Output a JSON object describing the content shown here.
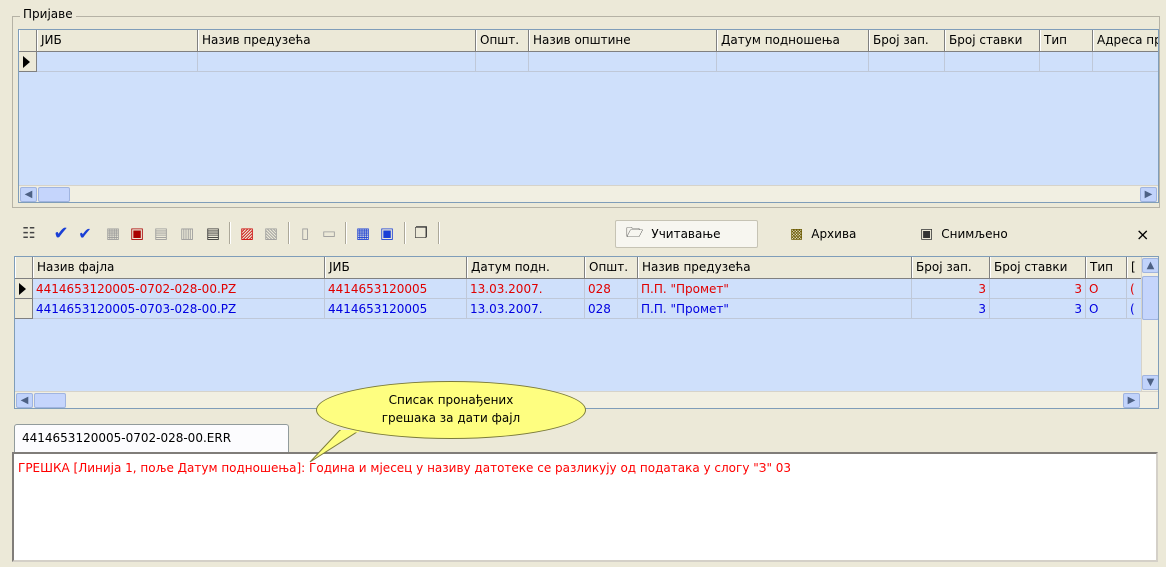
{
  "prijave": {
    "title": "Пријаве",
    "columns": [
      "ЈИБ",
      "Назив предузећа",
      "Општ.",
      "Назив општине",
      "Датум подношења",
      "Број зап.",
      "Број ставки",
      "Тип",
      "Адреса пр"
    ]
  },
  "toolbar": {
    "load_label": "Учитавање",
    "archive_label": "Архива",
    "saved_label": "Снимљено",
    "close_label": "×"
  },
  "files": {
    "columns": [
      "Назив фајла",
      "ЈИБ",
      "Датум подн.",
      "Општ.",
      "Назив предузећа",
      "Број зап.",
      "Број ставки",
      "Тип",
      "["
    ],
    "rows": [
      {
        "file": "4414653120005-0702-028-00.PZ",
        "jib": "4414653120005",
        "date": "13.03.2007.",
        "opst": "028",
        "company": "П.П. \"Промет\"",
        "records": "3",
        "items": "3",
        "type": "О",
        "extra": "(",
        "color": "#e00000"
      },
      {
        "file": "4414653120005-0703-028-00.PZ",
        "jib": "4414653120005",
        "date": "13.03.2007.",
        "opst": "028",
        "company": "П.П. \"Промет\"",
        "records": "3",
        "items": "3",
        "type": "О",
        "extra": "(",
        "color": "#0000e0"
      }
    ]
  },
  "callout": {
    "line1": "Списак пронађених",
    "line2": "грешака за дати фајл"
  },
  "error_tab": {
    "label": "4414653120005-0702-028-00.ERR"
  },
  "errors": {
    "text": "ГРЕШКА [Линија 1, поље Датум подношења]: Година и мјесец у називу датотеке се разликују од података у слогу \"З\" 03"
  },
  "colors": {
    "error_row": "#e00000",
    "ok_row": "#0000e0",
    "grid_bg": "#cfe0fb"
  }
}
